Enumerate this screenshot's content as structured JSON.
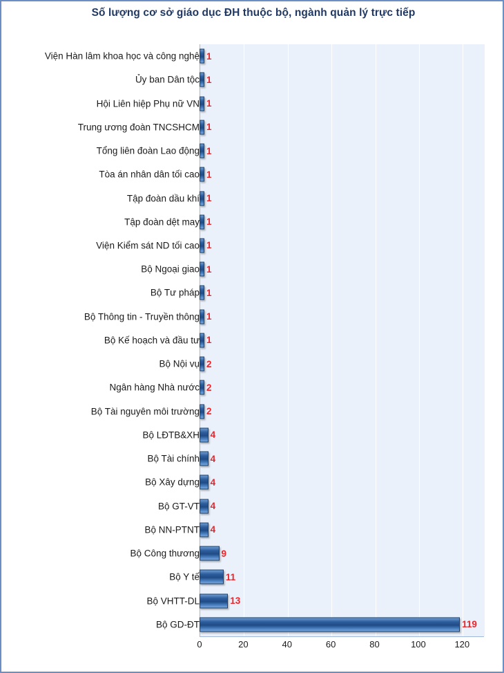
{
  "chart_data": {
    "type": "bar",
    "orientation": "horizontal",
    "title": "Số lượng cơ sở giáo dục ĐH thuộc bộ, ngành quản lý trực tiếp",
    "xlabel": "",
    "ylabel": "",
    "xlim": [
      0,
      130
    ],
    "xticks": [
      0,
      20,
      40,
      60,
      80,
      100,
      120
    ],
    "grid": true,
    "legend": false,
    "categories": [
      "Viện Hàn lâm khoa học và công nghệ",
      "Ủy ban Dân tộc",
      "Hội Liên hiệp Phụ nữ VN",
      "Trung ương đoàn TNCSHCM",
      "Tổng liên đoàn Lao động",
      "Tòa án nhân dân tối cao",
      "Tập đoàn dầu khí",
      "Tập đoàn dệt may",
      "Viện Kiểm sát ND tối cao",
      "Bộ Ngoại giao",
      "Bộ Tư pháp",
      "Bộ Thông tin - Truyền thông",
      "Bộ Kế hoạch và đầu tư",
      "Bộ Nội vụ",
      "Ngân hàng Nhà nước",
      "Bộ Tài nguyên môi trường",
      "Bộ LĐTB&XH",
      "Bộ Tài chính",
      "Bộ Xây dựng",
      "Bộ GT-VT",
      "Bộ NN-PTNT",
      "Bộ Công thương",
      "Bộ Y tế",
      "Bộ VHTT-DL",
      "Bộ GD-ĐT"
    ],
    "values": [
      1,
      1,
      1,
      1,
      1,
      1,
      1,
      1,
      1,
      1,
      1,
      1,
      1,
      2,
      2,
      2,
      4,
      4,
      4,
      4,
      4,
      9,
      11,
      13,
      119
    ],
    "value_labels": [
      "1",
      "1",
      "1",
      "1",
      "1",
      "1",
      "1",
      "1",
      "1",
      "1",
      "1",
      "1",
      "1",
      "2",
      "2",
      "2",
      "4",
      "4",
      "4",
      "4",
      "4",
      "9",
      "11",
      "13",
      "119"
    ],
    "colors": {
      "bar_fill": "#2f5f9e",
      "bar_edge": "#17406f",
      "value_label": "#e8262c",
      "title": "#1f3864",
      "plot_background": "#eaf1fb",
      "frame_border": "#6b8fc4",
      "gridline": "#ffffff"
    }
  }
}
